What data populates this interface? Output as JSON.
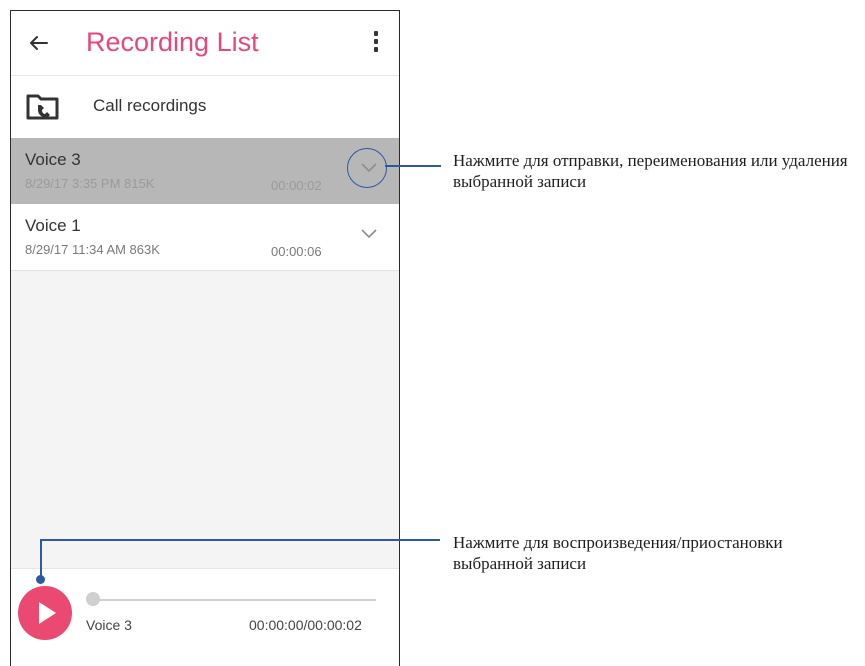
{
  "app_bar": {
    "title": "Recording List",
    "back_icon": "arrow-left-icon",
    "menu_icon": "overflow-menu-icon"
  },
  "folder": {
    "label": "Call recordings",
    "icon": "folder-call-icon"
  },
  "recordings": [
    {
      "name": "Voice 3",
      "meta": "8/29/17 3:35 PM  815K",
      "duration": "00:00:02",
      "selected": true
    },
    {
      "name": "Voice 1",
      "meta": "8/29/17 11:34 AM  863K",
      "duration": "00:00:06",
      "selected": false
    }
  ],
  "player": {
    "track_name": "Voice 3",
    "time": "00:00:00/00:00:02",
    "progress": 0
  },
  "callouts": {
    "options": "Нажмите для отправки, переименования или удаления выбранной записи",
    "play": "Нажмите для воспроизведения/приостановки выбранной записи"
  },
  "colors": {
    "accent": "#e8477a",
    "play_button": "#ea4a72",
    "selected_row": "#b7b7b7",
    "callout": "#2b5aa0"
  }
}
